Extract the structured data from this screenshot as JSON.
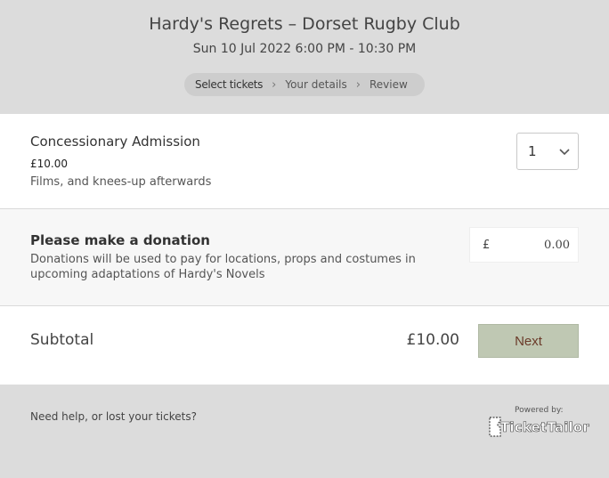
{
  "header": {
    "event_title": "Hardy's Regrets – Dorset Rugby Club",
    "event_date": "Sun 10 Jul 2022 6:00 PM - 10:30 PM",
    "steps": [
      "Select tickets",
      "Your details",
      "Review"
    ],
    "step_separator": "›"
  },
  "ticket": {
    "name": "Concessionary Admission",
    "price": "£10.00",
    "description": "Films, and knees-up afterwards",
    "quantity": "1"
  },
  "donation": {
    "title": "Please make a donation",
    "description": "Donations will be used to pay for locations, props and costumes in upcoming adaptations of Hardy's Novels",
    "currency": "£",
    "amount": "0.00"
  },
  "summary": {
    "subtotal_label": "Subtotal",
    "subtotal_amount": "£10.00",
    "next_label": "Next"
  },
  "footer": {
    "help_text": "Need help, or lost your tickets?",
    "powered_by": "Powered by:",
    "brand": "TicketTailor"
  },
  "colors": {
    "header_bg": "#dcdcdc",
    "footer_bg": "#dcdcdc",
    "next_button_bg": "#bfc8b3",
    "next_button_text": "#6b3b2a"
  },
  "icons": {
    "quantity_dropdown": "chevron-down-icon",
    "brand_logo": "ticket-icon"
  }
}
